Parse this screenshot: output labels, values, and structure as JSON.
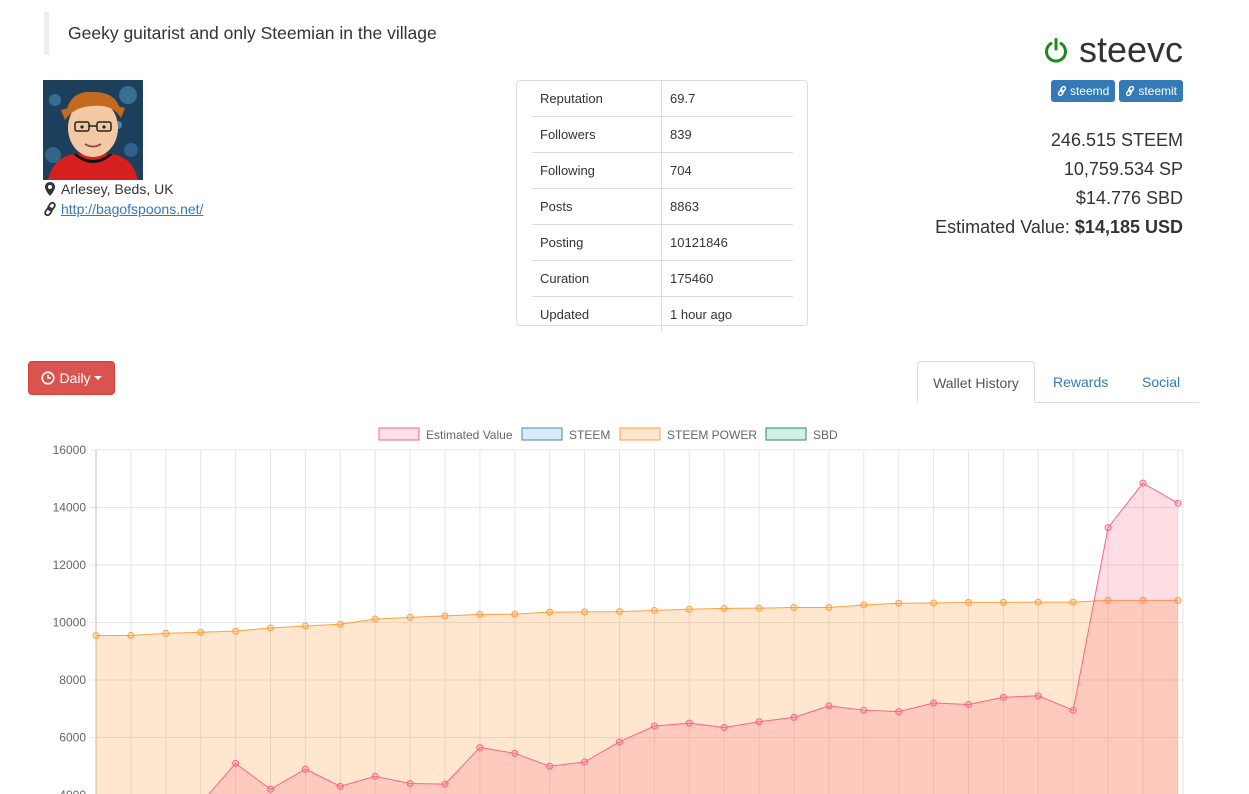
{
  "profile": {
    "bio": "Geeky guitarist and only Steemian in the village",
    "location": "Arlesey, Beds, UK",
    "website": "http://bagofspoons.net/",
    "username": "steevc",
    "links": [
      "steemd",
      "steemit"
    ]
  },
  "stats": [
    {
      "label": "Reputation",
      "value": "69.7"
    },
    {
      "label": "Followers",
      "value": "839"
    },
    {
      "label": "Following",
      "value": "704"
    },
    {
      "label": "Posts",
      "value": "8863"
    },
    {
      "label": "Posting",
      "value": "10121846"
    },
    {
      "label": "Curation",
      "value": "175460"
    },
    {
      "label": "Updated",
      "value": "1 hour ago"
    }
  ],
  "balances": {
    "steem": "246.515 STEEM",
    "sp": "10,759.534 SP",
    "sbd": "$14.776 SBD",
    "estimated_label": "Estimated Value:",
    "estimated_value": "$14,185 USD"
  },
  "controls": {
    "period_label": "Daily",
    "tabs": [
      "Wallet History",
      "Rewards",
      "Social"
    ]
  },
  "colors": {
    "online": "#1a8a1a",
    "danger": "#d9534f",
    "link": "#337ab7",
    "estimated_value": "#ff6384",
    "steem": "#36a2eb",
    "steem_power": "#ff9f40",
    "sbd": "#4bc0a0"
  },
  "chart_data": {
    "type": "area",
    "legend": [
      "Estimated Value",
      "STEEM",
      "STEEM POWER",
      "SBD"
    ],
    "legend_position": "top",
    "grid": true,
    "ylim": [
      4000,
      16000
    ],
    "yticks": [
      "16000",
      "14000",
      "12000",
      "10000",
      "8000",
      "6000",
      "4000"
    ],
    "series": [
      {
        "name": "STEEM POWER",
        "values": [
          9550,
          9550,
          9620,
          9660,
          9700,
          9810,
          9880,
          9940,
          10120,
          10180,
          10230,
          10280,
          10290,
          10360,
          10370,
          10380,
          10420,
          10460,
          10490,
          10500,
          10520,
          10520,
          10610,
          10670,
          10680,
          10700,
          10700,
          10710,
          10710,
          10770,
          10770,
          10770
        ]
      },
      {
        "name": "Estimated Value",
        "values": [
          3300,
          3300,
          3400,
          3700,
          5100,
          4200,
          4900,
          4300,
          4650,
          4400,
          4380,
          5650,
          5450,
          5000,
          5150,
          5850,
          6400,
          6500,
          6350,
          6550,
          6700,
          7100,
          6950,
          6900,
          7200,
          7150,
          7400,
          7450,
          6950,
          13300,
          14850,
          14150
        ]
      }
    ]
  }
}
